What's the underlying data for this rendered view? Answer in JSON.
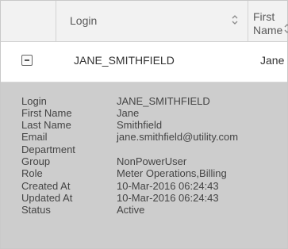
{
  "table": {
    "headers": {
      "login": "Login",
      "first_name": "First\nName"
    },
    "row": {
      "login": "JANE_SMITHFIELD",
      "first_name": "Jane"
    }
  },
  "detail": [
    {
      "label": "Login",
      "value": "JANE_SMITHFIELD"
    },
    {
      "label": "First Name",
      "value": "Jane"
    },
    {
      "label": "Last Name",
      "value": "Smithfield"
    },
    {
      "label": "Email",
      "value": "jane.smithfield@utility.com"
    },
    {
      "label": "Department",
      "value": ""
    },
    {
      "label": "Group",
      "value": "NonPowerUser"
    },
    {
      "label": "Role",
      "value": "Meter Operations,Billing"
    },
    {
      "label": "Created At",
      "value": "10-Mar-2016 06:24:43"
    },
    {
      "label": "Updated At",
      "value": "10-Mar-2016 06:24:43"
    },
    {
      "label": "Status",
      "value": "Active"
    }
  ],
  "icons": {
    "sort": "sort-icon",
    "collapse": "collapse-icon"
  },
  "colors": {
    "header_bg": "#f2f2f2",
    "detail_bg": "#cdcdcd"
  }
}
